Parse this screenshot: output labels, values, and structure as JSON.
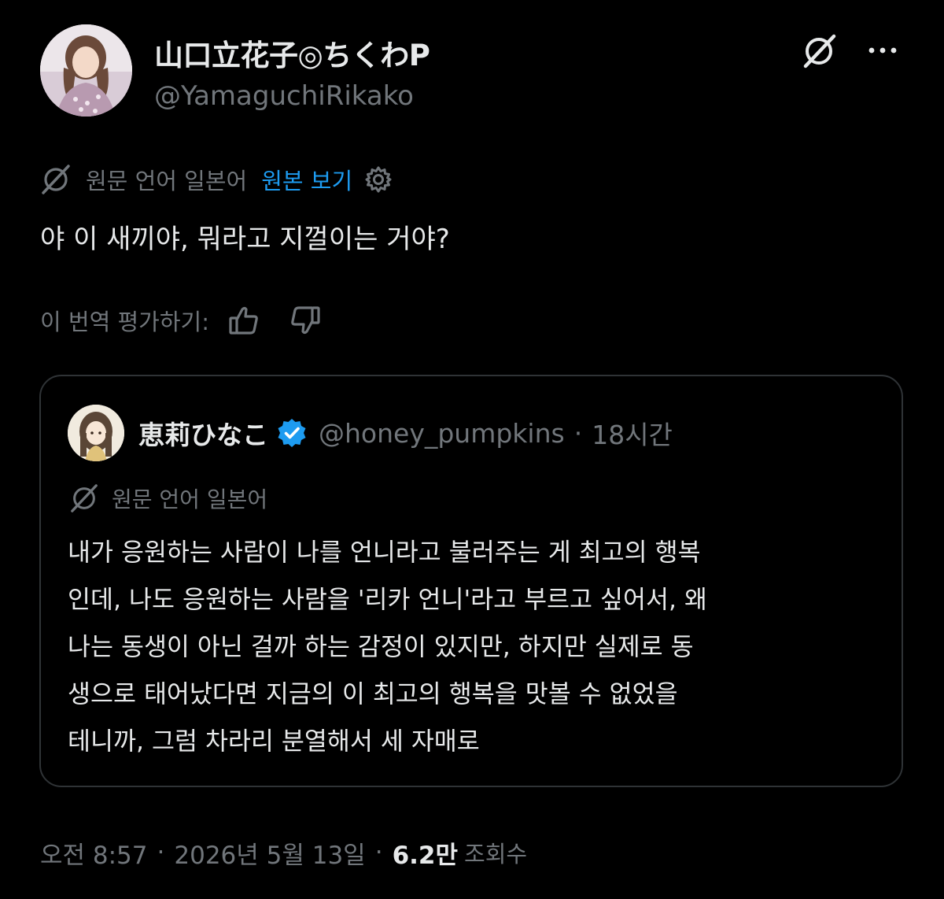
{
  "author": {
    "display_name": "山口立花子◎ちくわP",
    "handle": "@YamaguchiRikako",
    "avatar_icon": "profile-photo"
  },
  "header_actions": {
    "grok_icon": "grok-slash-icon",
    "more_icon": "ellipsis-icon"
  },
  "translation_notice": {
    "source_language_label": "원문 언어 일본어",
    "show_original_label": "원본 보기",
    "settings_icon": "gear-icon"
  },
  "tweet": {
    "text": "야 이 새끼야, 뭐라고 지껄이는 거야?"
  },
  "rate_translation": {
    "label": "이 번역 평가하기:",
    "thumbs_up_icon": "thumbs-up-icon",
    "thumbs_down_icon": "thumbs-down-icon"
  },
  "quoted_tweet": {
    "display_name": "恵莉ひなこ",
    "verified": true,
    "verified_color": "#1d9bf0",
    "handle": "@honey_pumpkins",
    "separator": "·",
    "time_ago": "18시간",
    "translation_notice": "원문 언어 일본어",
    "text_lines": [
      "내가 응원하는 사람이 나를 언니라고 불러주는 게 최고의 행복",
      "인데, 나도 응원하는 사람을 '리카 언니'라고 부르고 싶어서, 왜",
      "나는 동생이 아닌 걸까 하는 감정이 있지만, 하지만 실제로 동",
      "생으로 태어났다면 지금의 이 최고의 행복을 맛볼 수 없었을",
      "테니까, 그럼 차라리 분열해서 세 자매로"
    ]
  },
  "meta": {
    "time": "오전 8:57",
    "separator": "·",
    "date": "2026년 5월 13일",
    "views_count": "6.2만",
    "views_label": "조회수"
  },
  "colors": {
    "background": "#000000",
    "text_primary": "#e7e9ea",
    "text_secondary": "#71767b",
    "link": "#1d9bf0",
    "border": "#2f3336"
  }
}
